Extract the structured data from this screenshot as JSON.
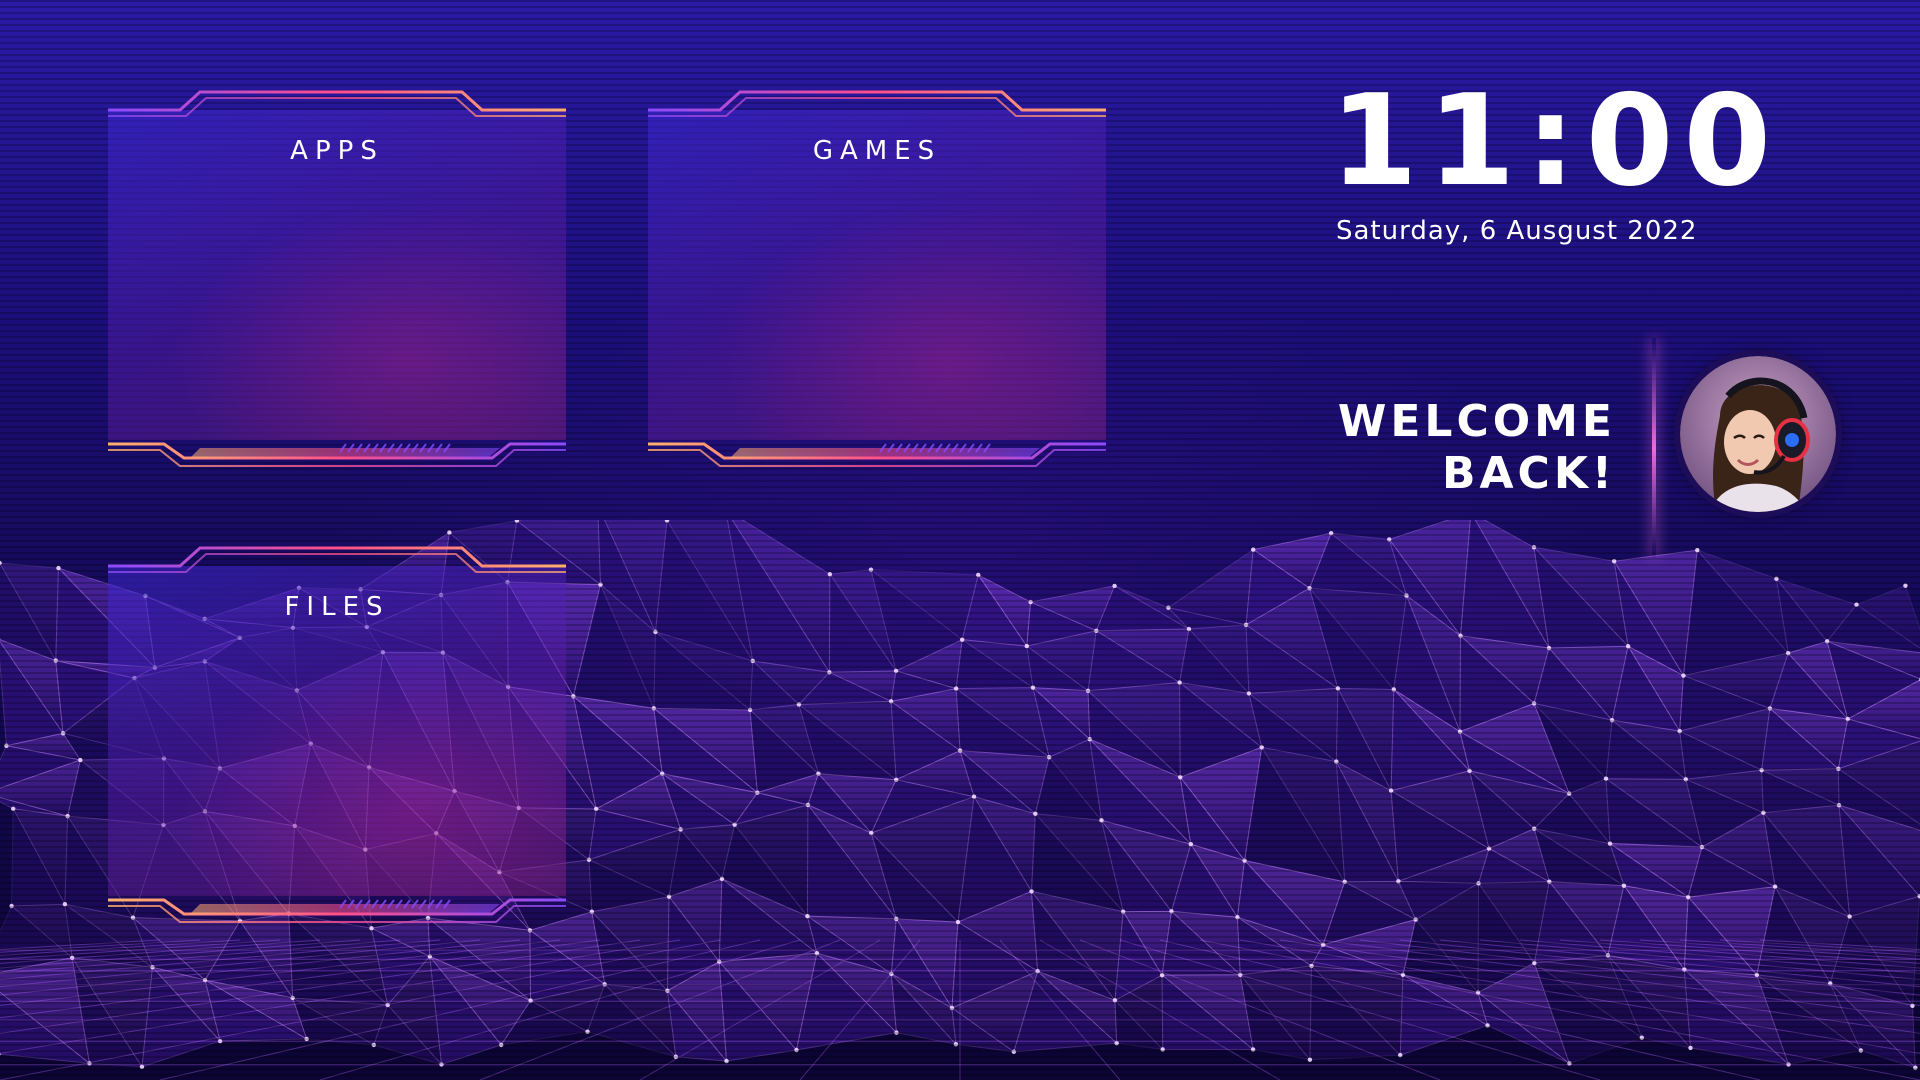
{
  "tiles": [
    {
      "id": "apps",
      "label": "APPS"
    },
    {
      "id": "games",
      "label": "GAMES"
    },
    {
      "id": "files",
      "label": "FILES"
    }
  ],
  "clock": {
    "time": "11:00",
    "date": "Saturday, 6 Ausgust 2022"
  },
  "welcome": {
    "line1": "WELCOME",
    "line2": "BACK!"
  },
  "user": {
    "avatar_icon": "user-avatar-headset"
  },
  "colors": {
    "background": "#1c0e7a",
    "accent_orange": "#ffb070",
    "accent_pink": "#ff4f8a",
    "accent_purple": "#8a4bff",
    "terrain": "#9b4dff",
    "text": "#ffffff"
  }
}
